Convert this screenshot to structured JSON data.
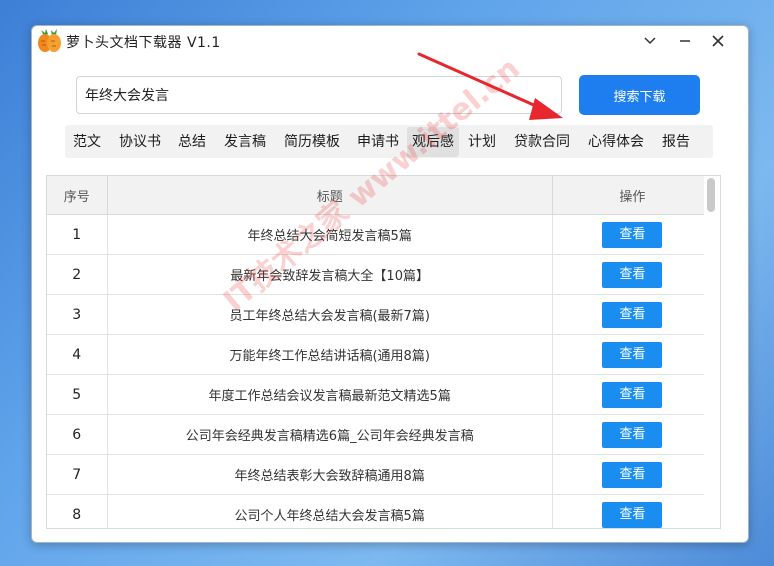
{
  "window": {
    "title": "萝卜头文档下载器  V1.1"
  },
  "search": {
    "value": "年终大会发言",
    "button_label": "搜索下载"
  },
  "categories": [
    "范文",
    "协议书",
    "总结",
    "发言稿",
    "简历模板",
    "申请书",
    "观后感",
    "计划",
    "贷款合同",
    "心得体会",
    "报告"
  ],
  "active_category": "观后感",
  "table": {
    "headers": [
      "序号",
      "标题",
      "操作"
    ],
    "rows": [
      {
        "idx": "1",
        "title": "年终总结大会简短发言稿5篇",
        "action": "查看"
      },
      {
        "idx": "2",
        "title": "最新年会致辞发言稿大全【10篇】",
        "action": "查看"
      },
      {
        "idx": "3",
        "title": "员工年终总结大会发言稿(最新7篇)",
        "action": "查看"
      },
      {
        "idx": "4",
        "title": "万能年终工作总结讲话稿(通用8篇)",
        "action": "查看"
      },
      {
        "idx": "5",
        "title": "年度工作总结会议发言稿最新范文精选5篇",
        "action": "查看"
      },
      {
        "idx": "6",
        "title": "公司年会经典发言稿精选6篇_公司年会经典发言稿",
        "action": "查看"
      },
      {
        "idx": "7",
        "title": "年终总结表彰大会致辞稿通用8篇",
        "action": "查看"
      },
      {
        "idx": "8",
        "title": "公司个人年终总结大会发言稿5篇",
        "action": "查看"
      }
    ]
  },
  "watermark": "IT技术之家 www.ittel.cn",
  "colors": {
    "accent": "#1e7ef0",
    "view_button": "#1a8df0",
    "arrow": "#e8262d"
  }
}
